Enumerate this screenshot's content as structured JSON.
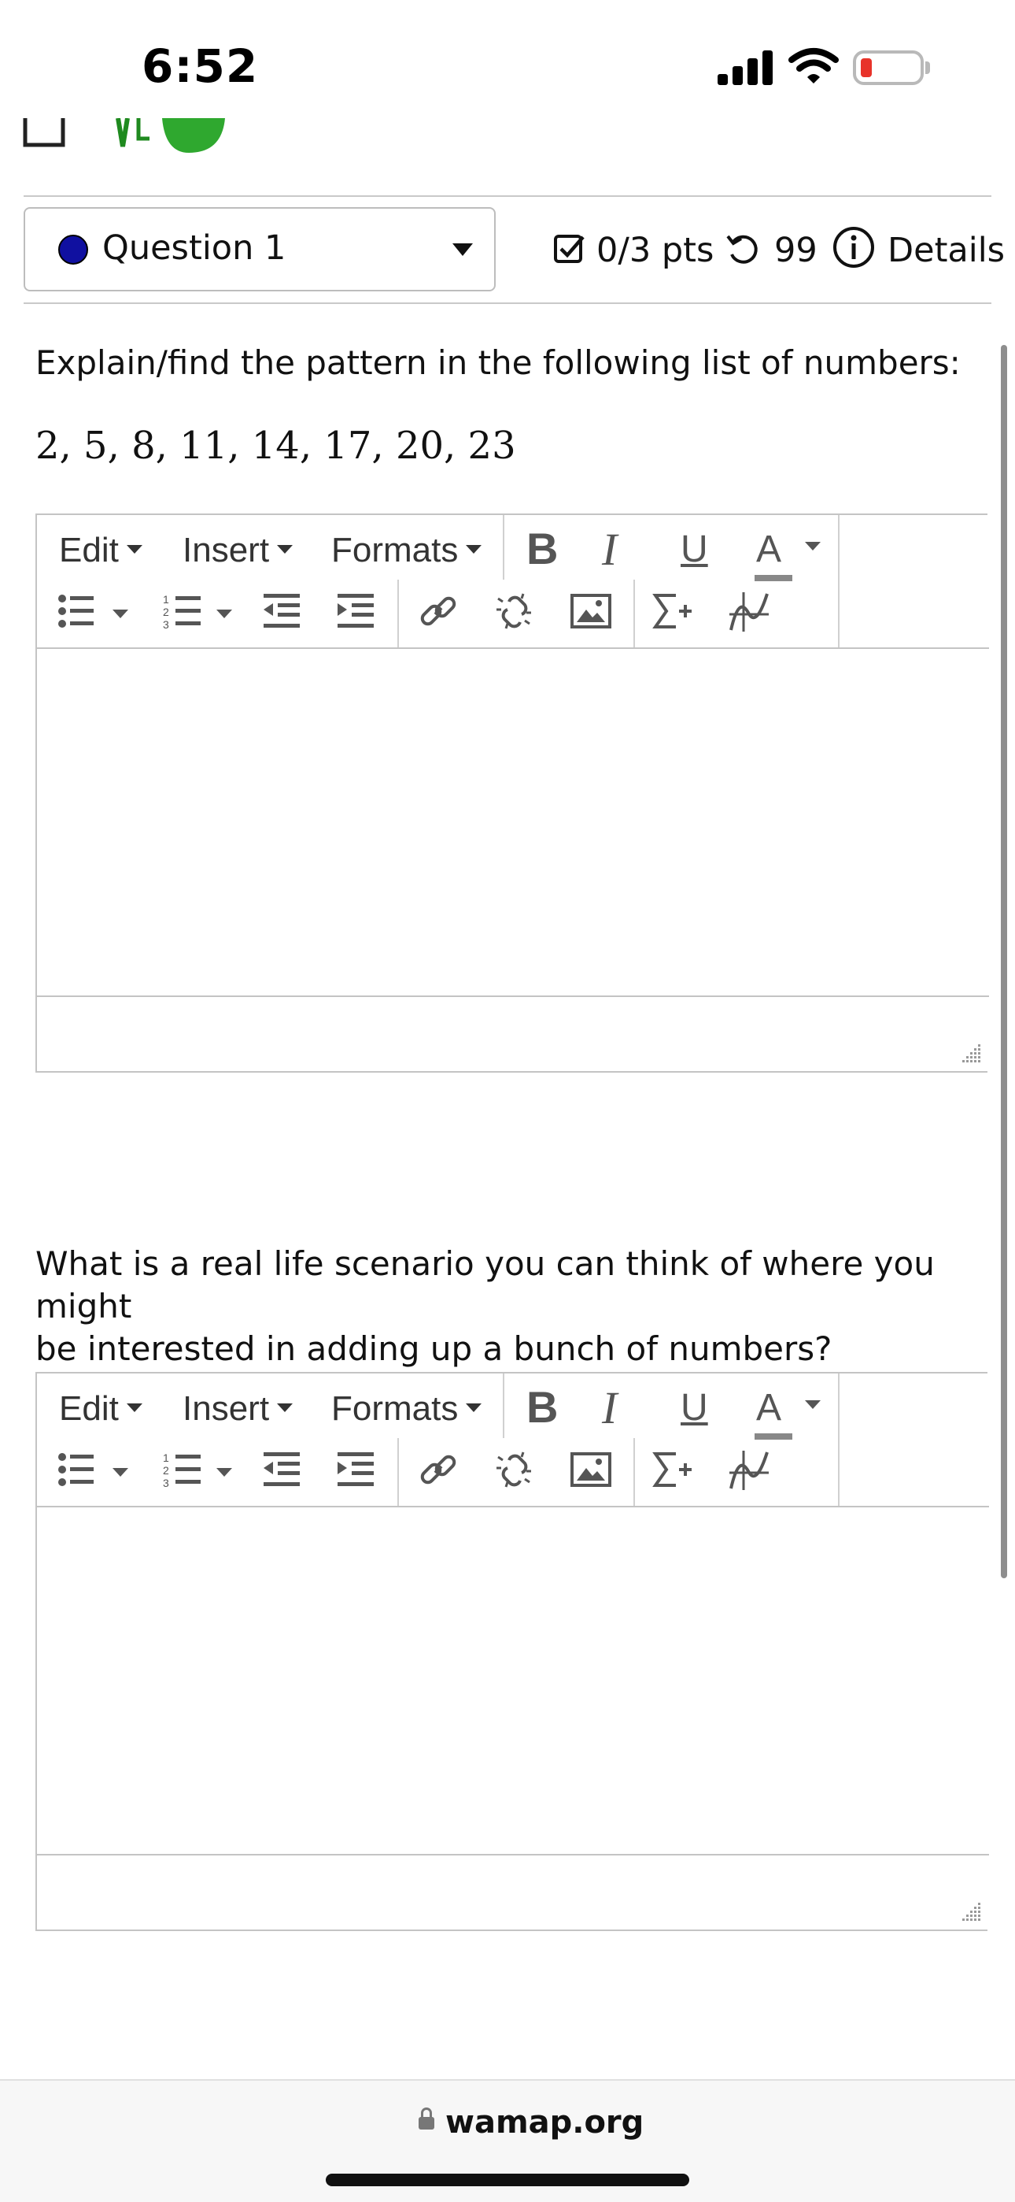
{
  "status_bar": {
    "time": "6:52"
  },
  "question_header": {
    "question_label": "Question 1",
    "score": "0/3 pts",
    "attempts": "99",
    "details_label": "Details"
  },
  "questions": [
    {
      "prompt": "Explain/find the pattern in the following list of numbers:",
      "sequence": "2, 5, 8, 11, 14, 17, 20, 23"
    },
    {
      "prompt_line1": "What is a real life scenario you can think of where you might",
      "prompt_line2": "be interested in adding up a bunch of numbers?"
    }
  ],
  "editor_toolbar": {
    "edit": "Edit",
    "insert": "Insert",
    "formats": "Formats",
    "bold": "B",
    "italic": "I",
    "underline": "U",
    "font_color": "A"
  },
  "browser": {
    "url": "wamap.org"
  },
  "colors": {
    "question_dot": "#1010a0",
    "battery_low": "#e8332a",
    "toolbar_icon": "#555555"
  }
}
